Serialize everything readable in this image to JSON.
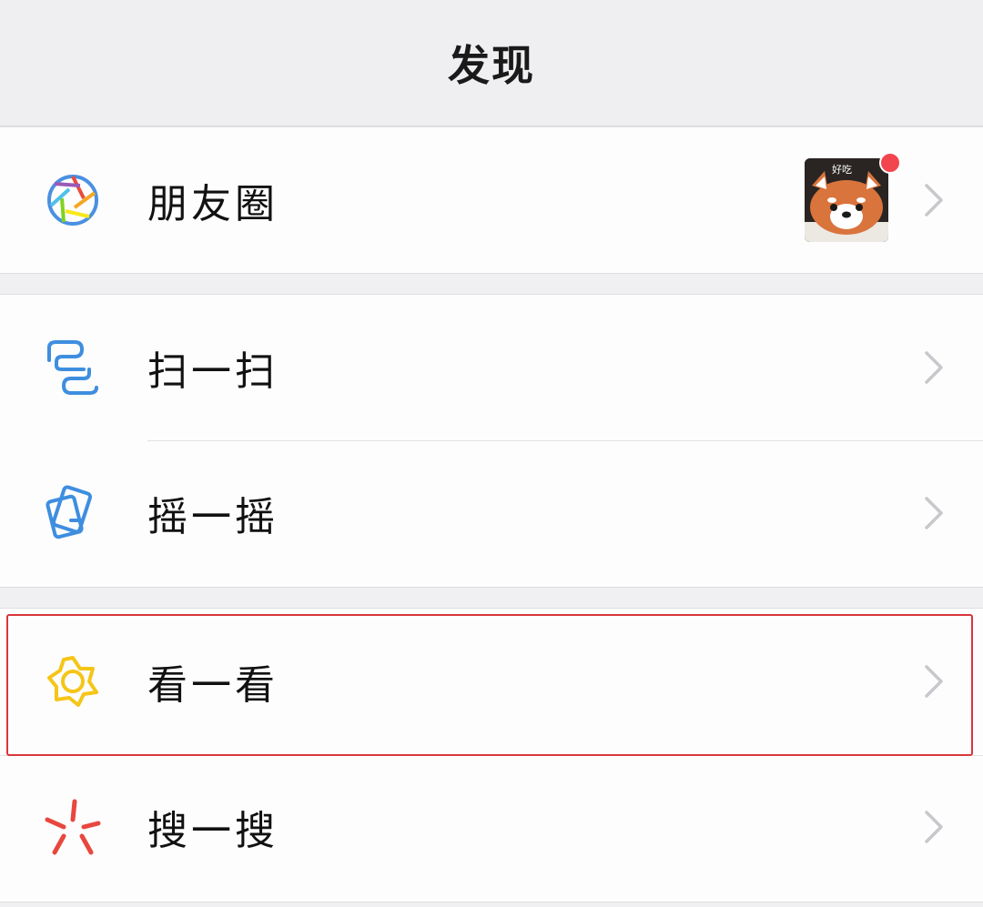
{
  "header": {
    "title": "发现"
  },
  "groups": [
    {
      "items": [
        {
          "label": "朋友圈",
          "icon": "moments-aperture-icon",
          "has_thumbnail": true,
          "badge_dot": true
        }
      ]
    },
    {
      "items": [
        {
          "label": "扫一扫",
          "icon": "scan-icon"
        },
        {
          "label": "摇一摇",
          "icon": "shake-icon"
        }
      ]
    },
    {
      "items": [
        {
          "label": "看一看",
          "icon": "top-stories-icon",
          "highlighted": true
        },
        {
          "label": "搜一搜",
          "icon": "search-burst-icon"
        }
      ]
    }
  ],
  "thumbnail": {
    "text": "好吃"
  },
  "colors": {
    "header_bg": "#efeff1",
    "row_bg": "#fdfdfd",
    "badge": "#f3454e",
    "highlight_border": "#d9363a",
    "scan_blue": "#3e8ee0",
    "top_stories_yellow": "#f5c518",
    "search_red": "#e8473f",
    "chevron": "#c7c7cc"
  }
}
